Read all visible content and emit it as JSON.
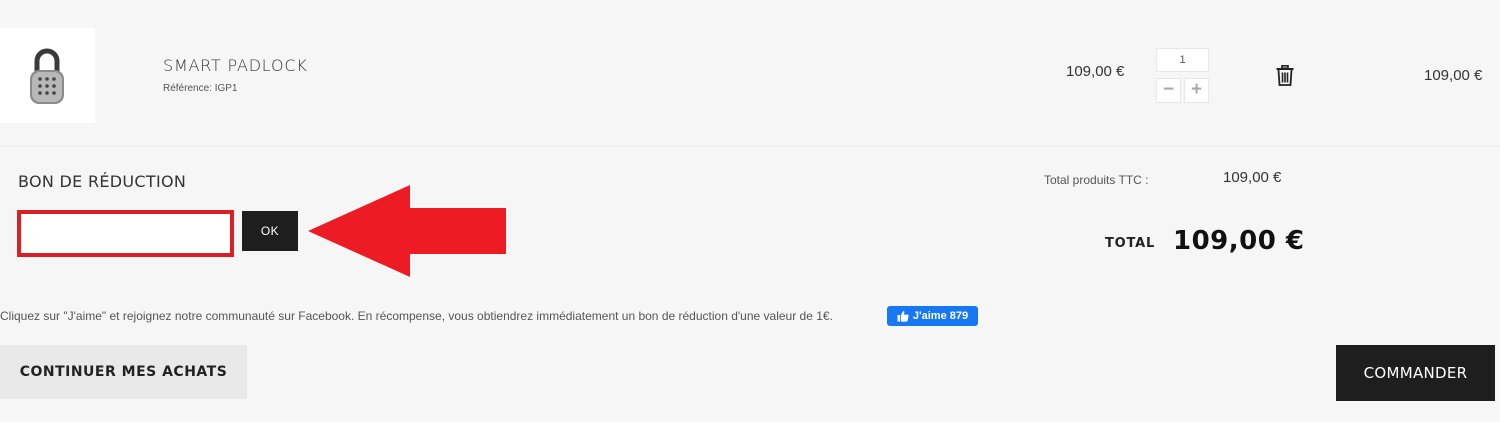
{
  "cart_item": {
    "name": "SMART PADLOCK",
    "reference": "Référence: IGP1",
    "unit_price": "109,00 €",
    "quantity": "1",
    "line_total": "109,00 €",
    "image_icon": "padlock-product-image",
    "minus_symbol": "−",
    "plus_symbol": "+",
    "delete_icon": "trash-icon"
  },
  "coupon": {
    "title": "BON DE RÉDUCTION",
    "input_value": "",
    "input_placeholder": "",
    "button_label": "OK",
    "highlight_color": "#d92027",
    "annotation_icon": "red-arrow-icon"
  },
  "totals": {
    "products_label": "Total produits TTC :",
    "products_value": "109,00 €",
    "total_label": "TOTAL",
    "total_value": "109,00 €"
  },
  "facebook": {
    "note": "Cliquez sur \"J'aime\" et rejoignez notre communauté sur Facebook. En récompense, vous obtiendrez immédiatement un bon de réduction d'une valeur de 1€.",
    "like_label": "J'aime 879",
    "like_color": "#1877f2",
    "like_icon": "thumbs-up-icon"
  },
  "actions": {
    "continue_label": "CONTINUER MES ACHATS",
    "order_label": "COMMANDER"
  }
}
